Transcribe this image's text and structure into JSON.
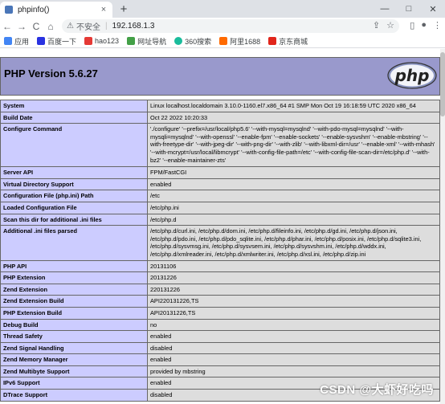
{
  "browser": {
    "tab_title": "phpinfo()",
    "new_tab": "+",
    "tab_close": "×",
    "win_min": "—",
    "win_max": "□",
    "win_close": "✕",
    "insecure_label": "不安全",
    "separator": "|",
    "url": "192.168.1.3",
    "back": "←",
    "forward": "→",
    "reload": "C",
    "home": "⌂"
  },
  "bookmarks": [
    {
      "label": "应用",
      "color": "#4285f4"
    },
    {
      "label": "百度一下",
      "color": "#2932e1"
    },
    {
      "label": "hao123",
      "color": "#e53935"
    },
    {
      "label": "网址导航",
      "color": "#43a047"
    },
    {
      "label": "360搜索",
      "color": "#1abc9c"
    },
    {
      "label": "阿里1688",
      "color": "#ff6a00"
    },
    {
      "label": "京东商城",
      "color": "#e1251b"
    }
  ],
  "php": {
    "version_title": "PHP Version 5.6.27",
    "logo_text": "php"
  },
  "rows": [
    {
      "k": "System",
      "v": "Linux localhost.localdomain 3.10.0-1160.el7.x86_64 #1 SMP Mon Oct 19 16:18:59 UTC 2020 x86_64"
    },
    {
      "k": "Build Date",
      "v": "Oct 22 2022 10:20:33"
    },
    {
      "k": "Configure Command",
      "v": "'./configure' '--prefix=/usr/local/php5.6' '--with-mysql=mysqlnd' '--with-pdo-mysql=mysqlnd' '--with-mysqli=mysqlnd' '--with-openssl' '--enable-fpm' '--enable-sockets' '--enable-sysvshm' '--enable-mbstring' '--with-freetype-dir' '--with-jpeg-dir' '--with-png-dir' '--with-zlib' '--with-libxml-dir=/usr' '--enable-xml' '--with-mhash' '--with-mcrypt=/usr/local/libmcrypt' '--with-config-file-path=/etc' '--with-config-file-scan-dir=/etc/php.d' '--with-bz2' '--enable-maintainer-zts'"
    },
    {
      "k": "Server API",
      "v": "FPM/FastCGI"
    },
    {
      "k": "Virtual Directory Support",
      "v": "enabled"
    },
    {
      "k": "Configuration File (php.ini) Path",
      "v": "/etc"
    },
    {
      "k": "Loaded Configuration File",
      "v": "/etc/php.ini"
    },
    {
      "k": "Scan this dir for additional .ini files",
      "v": "/etc/php.d"
    },
    {
      "k": "Additional .ini files parsed",
      "v": "/etc/php.d/curl.ini, /etc/php.d/dom.ini, /etc/php.d/fileinfo.ini, /etc/php.d/gd.ini, /etc/php.d/json.ini, /etc/php.d/pdo.ini, /etc/php.d/pdo_sqlite.ini, /etc/php.d/phar.ini, /etc/php.d/posix.ini, /etc/php.d/sqlite3.ini, /etc/php.d/sysvmsg.ini, /etc/php.d/sysvsem.ini, /etc/php.d/sysvshm.ini, /etc/php.d/wddx.ini, /etc/php.d/xmlreader.ini, /etc/php.d/xmlwriter.ini, /etc/php.d/xsl.ini, /etc/php.d/zip.ini"
    },
    {
      "k": "PHP API",
      "v": "20131106"
    },
    {
      "k": "PHP Extension",
      "v": "20131226"
    },
    {
      "k": "Zend Extension",
      "v": "220131226"
    },
    {
      "k": "Zend Extension Build",
      "v": "API220131226,TS"
    },
    {
      "k": "PHP Extension Build",
      "v": "API20131226,TS"
    },
    {
      "k": "Debug Build",
      "v": "no"
    },
    {
      "k": "Thread Safety",
      "v": "enabled"
    },
    {
      "k": "Zend Signal Handling",
      "v": "disabled"
    },
    {
      "k": "Zend Memory Manager",
      "v": "enabled"
    },
    {
      "k": "Zend Multibyte Support",
      "v": "provided by mbstring"
    },
    {
      "k": "IPv6 Support",
      "v": "enabled"
    },
    {
      "k": "DTrace Support",
      "v": "disabled"
    }
  ],
  "watermark": "CSDN @大虾好吃吗"
}
